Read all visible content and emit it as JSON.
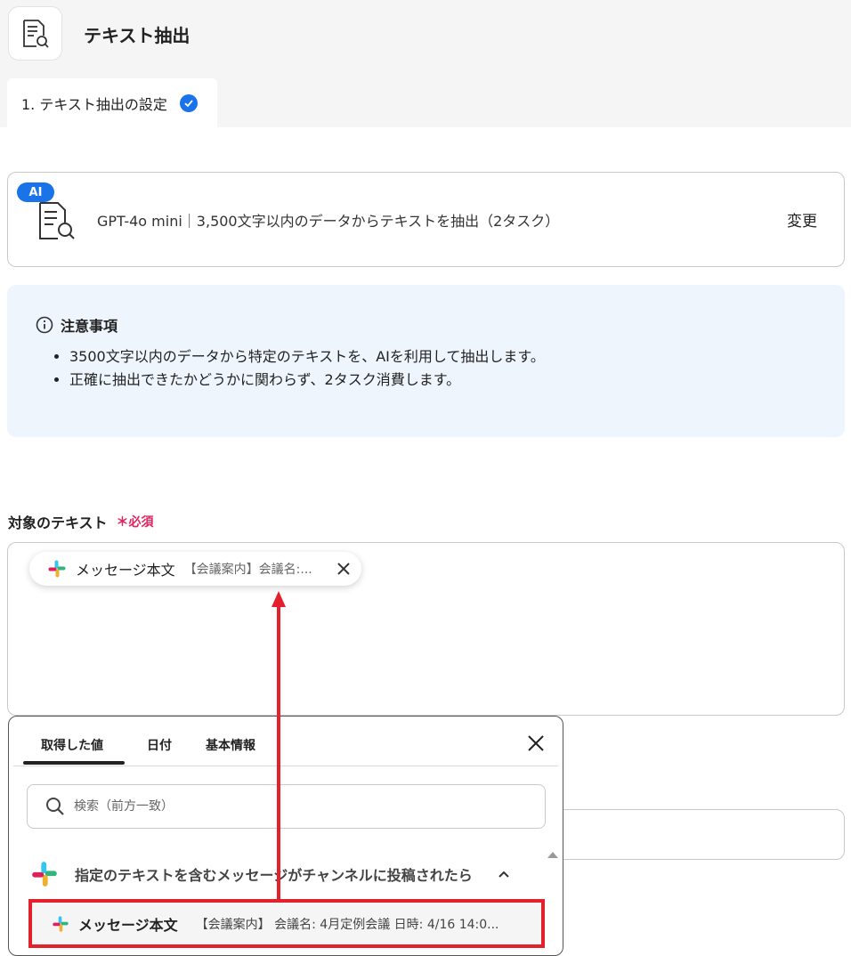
{
  "app": {
    "title": "テキスト抽出"
  },
  "step_tab": {
    "label": "1. テキスト抽出の設定"
  },
  "model_card": {
    "badge": "AI",
    "description": "GPT-4o mini｜3,500文字以内のデータからテキストを抽出（2タスク）",
    "change_label": "変更"
  },
  "notice": {
    "title": "注意事項",
    "items": [
      "3500文字以内のデータから特定のテキストを、AIを利用して抽出します。",
      "正確に抽出できたかどうかに関わらず、2タスク消費します。"
    ]
  },
  "target_field": {
    "label": "対象のテキスト",
    "required": "＊必須",
    "chip": {
      "label": "メッセージ本文",
      "preview": "【会議案内】会議名:..."
    }
  },
  "panel": {
    "tabs": [
      "取得した値",
      "日付",
      "基本情報"
    ],
    "search_placeholder": "検索（前方一致）",
    "group_title": "指定のテキストを含むメッセージがチャンネルに投稿されたら",
    "value_row": {
      "label": "メッセージ本文",
      "preview": "【会議案内】 会議名: 4月定例会議 日時: 4/16 14:0..."
    }
  },
  "colors": {
    "accent": "#1a73e8",
    "annotation": "#e4202c",
    "notice_bg": "#eef5fc",
    "required": "#e0245e"
  }
}
